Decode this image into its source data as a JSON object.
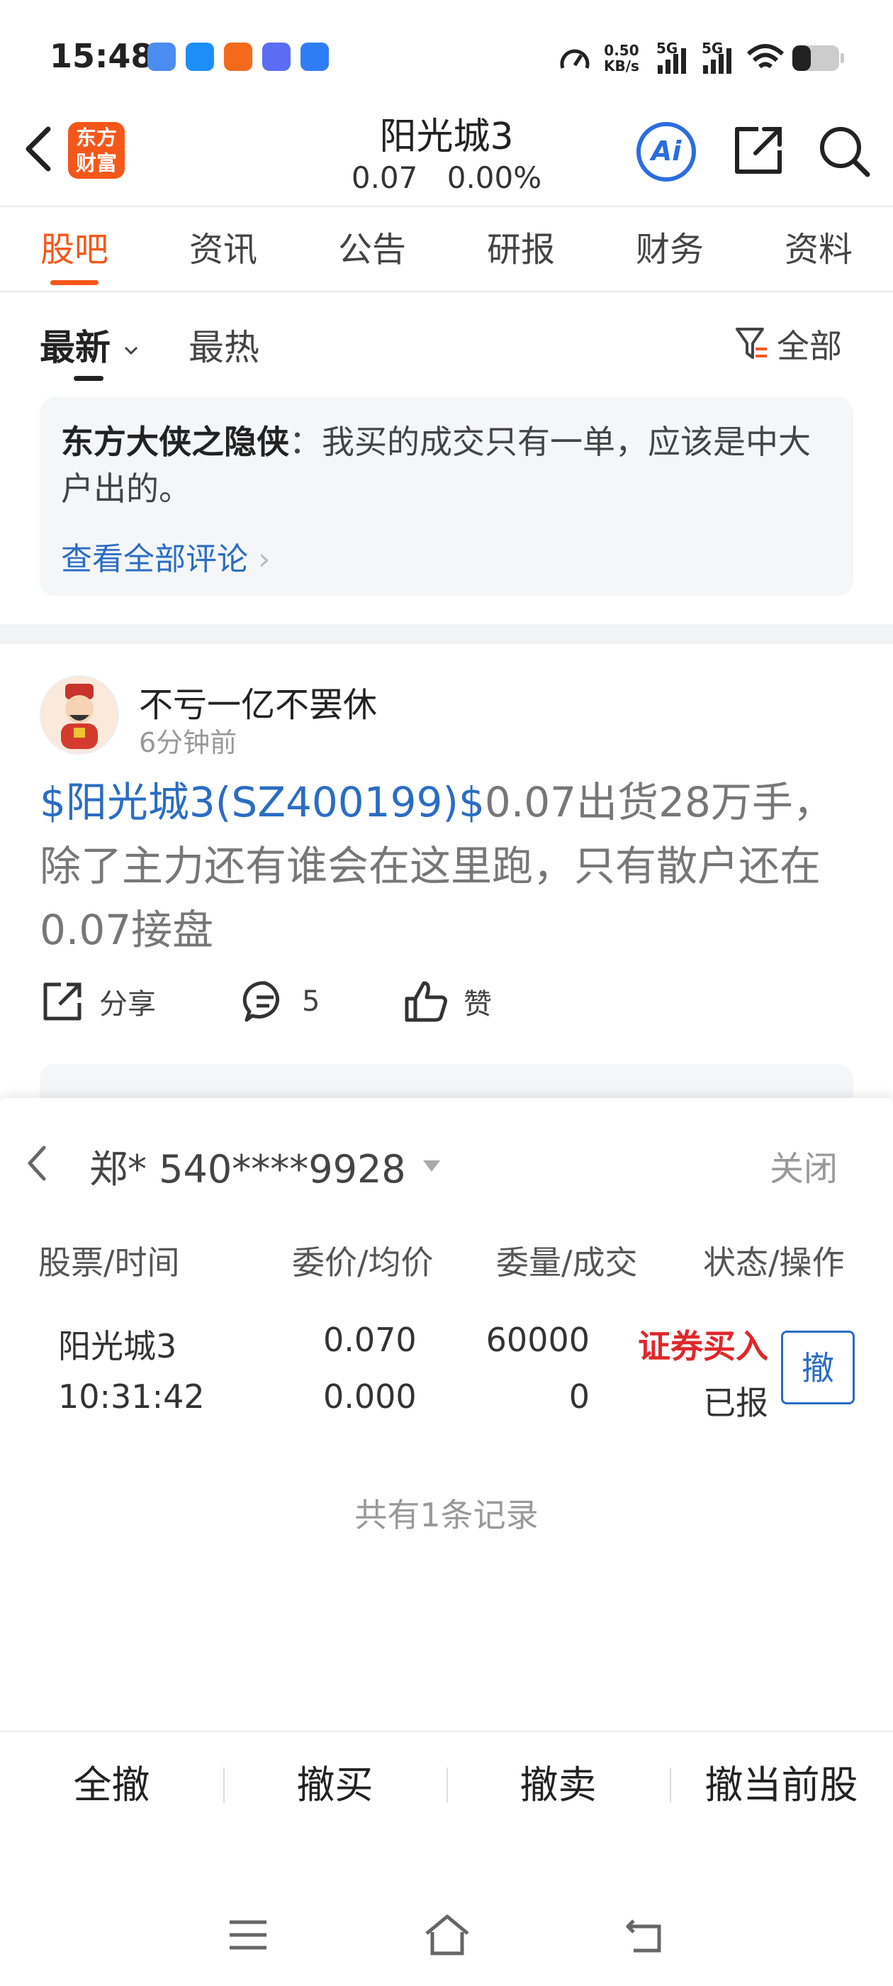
{
  "status_bar": {
    "time": "15:48",
    "net_speed_value": "0.50",
    "net_speed_unit": "KB/s",
    "signal1": "5G",
    "signal2": "5G",
    "app_icon_colors": [
      "#4a8cf0",
      "#1e8ef7",
      "#f56a1b",
      "#5b6df2",
      "#2f7df6"
    ]
  },
  "header": {
    "logo_line1": "东方",
    "logo_line2": "财富",
    "title": "阳光城3",
    "price": "0.07",
    "change": "0.00%",
    "ai_label": "Ai"
  },
  "tabs": [
    "股吧",
    "资讯",
    "公告",
    "研报",
    "财务",
    "资料"
  ],
  "sort": {
    "latest": "最新",
    "hot": "最热",
    "filter": "全部"
  },
  "comment_preview": {
    "user": "东方大侠之隐侠",
    "text": "：我买的成交只有一单，应该是中大户出的。",
    "link": "查看全部评论"
  },
  "post": {
    "author": "不亏一亿不罢休",
    "time": "6分钟前",
    "stock_tag": "$阳光城3(SZ400199)$",
    "body": "0.07出货28万手，除了主力还有谁会在这里跑，只有散户还在0.07接盘",
    "share_label": "分享",
    "comment_count": "5",
    "like_label": "赞"
  },
  "panel": {
    "account": "郑* 540****9928",
    "close": "关闭",
    "headers": [
      "股票/时间",
      "委价/均价",
      "委量/成交",
      "状态/操作"
    ],
    "order": {
      "stock": "阳光城3",
      "time": "10:31:42",
      "price": "0.070",
      "avg_price": "0.000",
      "qty": "60000",
      "filled": "0",
      "direction": "证券买入",
      "status": "已报",
      "cancel": "撤"
    },
    "records": "共有1条记录",
    "buttons": [
      "全撤",
      "撤买",
      "撤卖",
      "撤当前股"
    ]
  }
}
